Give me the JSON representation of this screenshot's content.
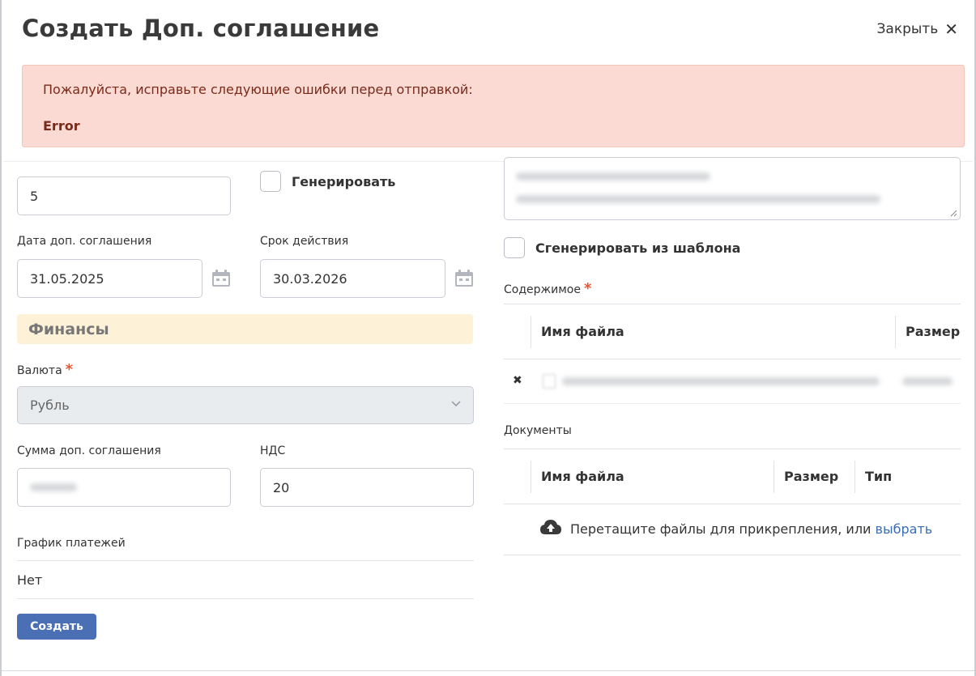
{
  "modal": {
    "title": "Создать Доп. соглашение",
    "close_label": "Закрыть"
  },
  "alert": {
    "message": "Пожалуйста, исправьте следующие ошибки перед отправкой:",
    "error": "Error"
  },
  "form": {
    "number_value": "5",
    "generate_label": "Генерировать",
    "date_label": "Дата доп. соглашения",
    "date_value": "31.05.2025",
    "term_label": "Срок действия",
    "term_value": "30.03.2026",
    "finance_section": "Финансы",
    "currency_label": "Валюта",
    "currency_value": "Рубль",
    "amount_label": "Сумма доп. соглашения",
    "vat_label": "НДС",
    "vat_value": "20",
    "schedule_label": "График платежей",
    "schedule_value": "Нет",
    "create_button": "Создать",
    "required_mark": "*"
  },
  "right": {
    "template_label": "Сгенерировать из шаблона",
    "content_label": "Содержимое",
    "content_table": {
      "col_name": "Имя файла",
      "col_size": "Размер"
    },
    "documents_label": "Документы",
    "documents_table": {
      "col_name": "Имя файла",
      "col_size": "Размер",
      "col_type": "Тип"
    },
    "drop_text": "Перетащите файлы для прикрепления, или",
    "drop_link": "выбрать"
  },
  "colors": {
    "accent": "#4a6fb5",
    "alert_bg": "#fadad2",
    "section_bg": "#fdf2d7",
    "required": "#e8542f",
    "link": "#3b6db3"
  },
  "icons": [
    "close-icon",
    "calendar-icon",
    "chevron-down-icon",
    "remove-icon",
    "cloud-upload-icon",
    "file-icon"
  ]
}
